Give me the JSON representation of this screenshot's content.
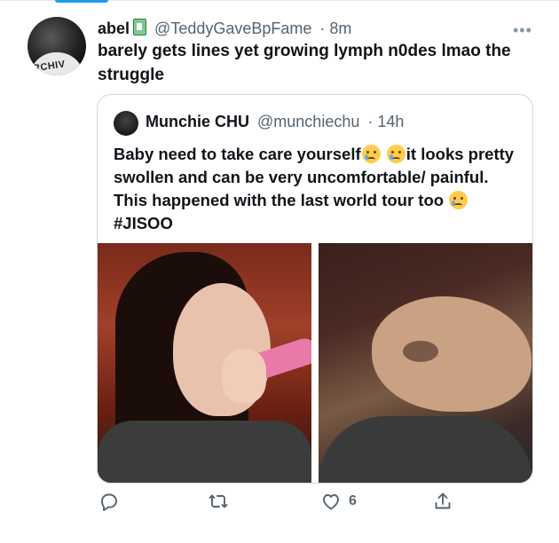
{
  "tweet": {
    "author_name": "abel",
    "author_handle": "@TeddyGaveBpFame",
    "time": "· 8m",
    "text": "barely gets lines yet growing lymph n0des lmao the struggle",
    "avatar_text": "RCHIV"
  },
  "quote": {
    "author_name": "Munchie CHU",
    "author_handle": "@munchiechu",
    "time": "· 14h",
    "text_1": "Baby need to take care yourself",
    "text_2": "it looks pretty swollen and can be very uncomfortable/ painful. This happened with the last world tour too",
    "hashtag": "#JISOO"
  },
  "actions": {
    "like_count": "6"
  },
  "colors": {
    "accent": "#1d9bf0",
    "text": "#0f1419",
    "secondary": "#536471",
    "border": "#cfd9de"
  }
}
